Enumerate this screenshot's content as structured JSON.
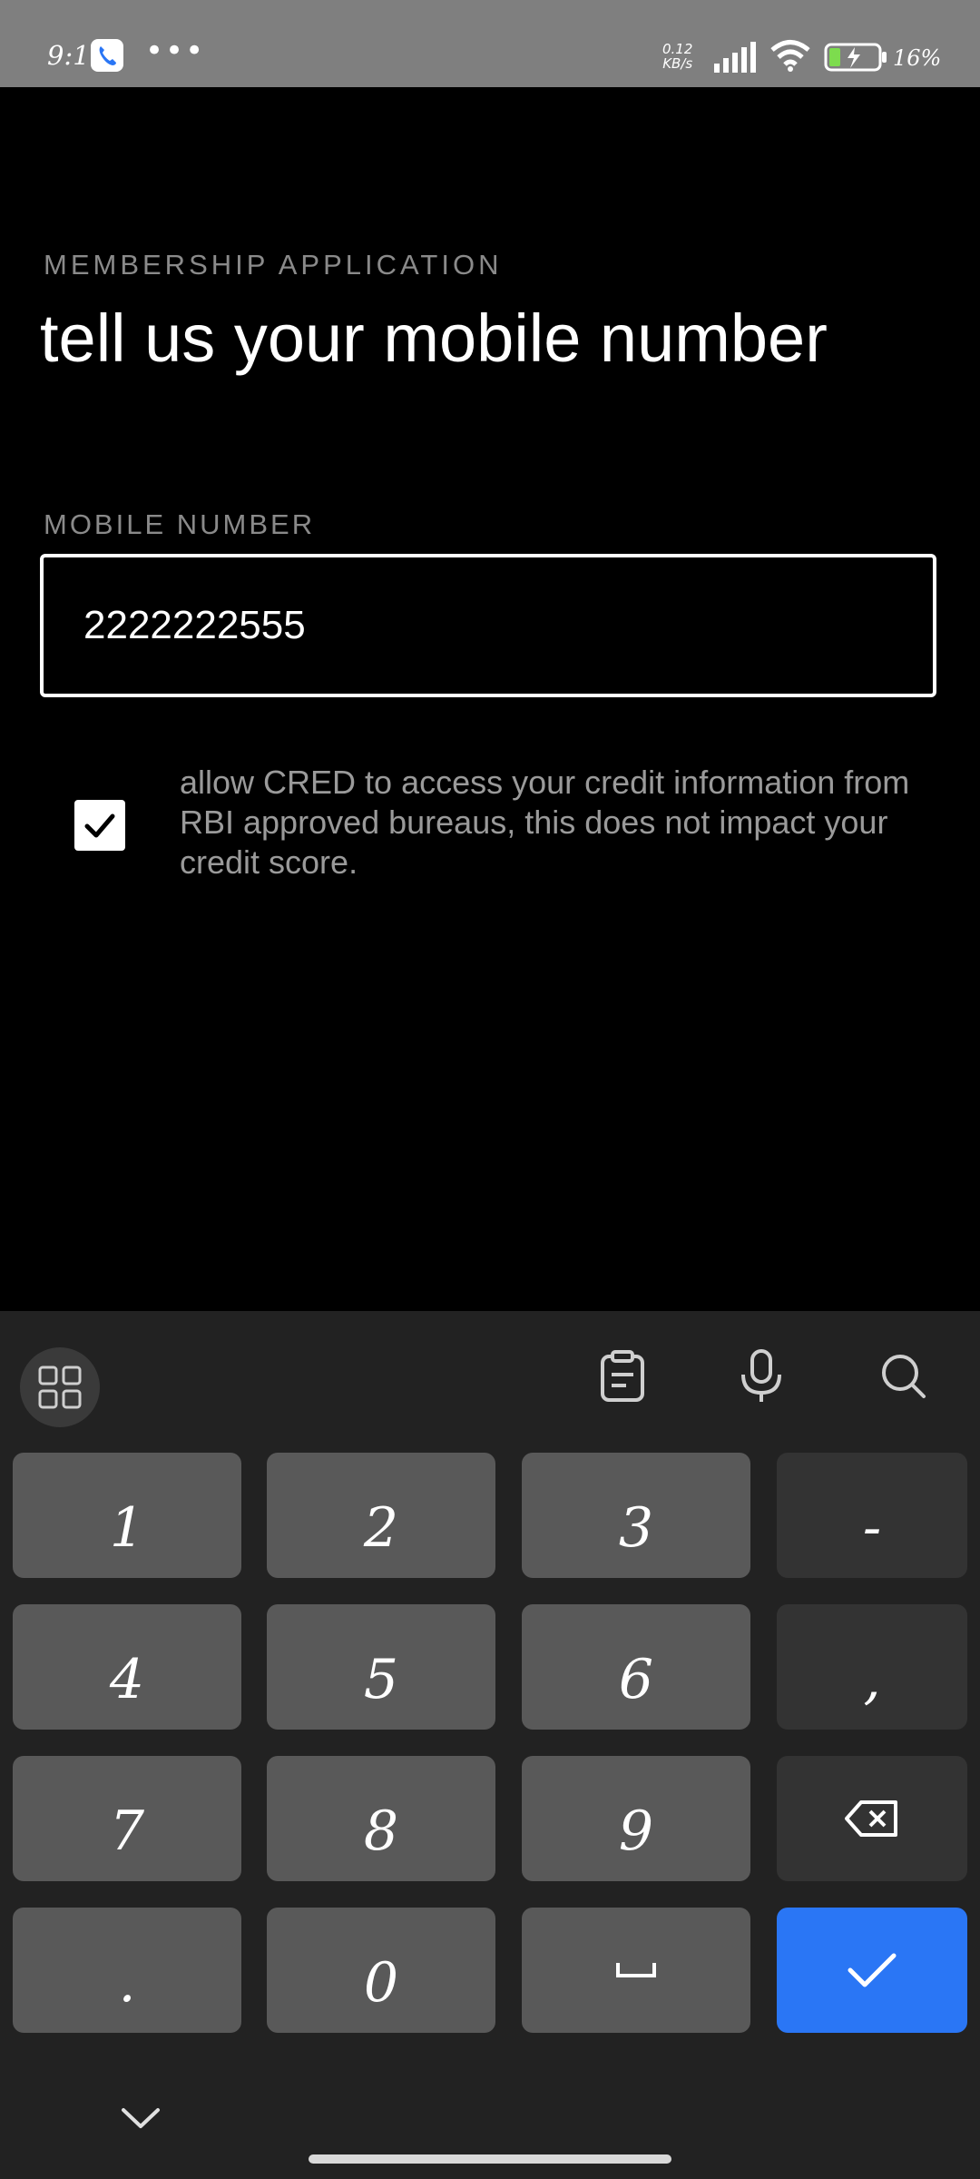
{
  "status_bar": {
    "time": "9:11",
    "dots": "•••",
    "speed_value": "0.12",
    "speed_unit": "KB/s",
    "battery_percent": "16%"
  },
  "form": {
    "eyebrow": "MEMBERSHIP APPLICATION",
    "title": "tell us your mobile number",
    "field_label": "MOBILE NUMBER",
    "field_value": "2222222555",
    "consent_checked": true,
    "consent_text": "allow CRED to access your credit information from RBI approved bureaus, this does not impact your credit score."
  },
  "keyboard": {
    "keys": [
      "1",
      "2",
      "3",
      "-",
      "4",
      "5",
      "6",
      ",",
      "7",
      "8",
      "9",
      "⌫",
      ".",
      "0",
      "␣",
      "✓"
    ],
    "toolbar_icons": [
      "grid-icon",
      "clipboard-icon",
      "mic-icon",
      "search-icon"
    ]
  },
  "colors": {
    "background": "#000000",
    "keyboard_bg": "#222222",
    "key_bg": "#595959",
    "enter_key": "#2a76f5"
  }
}
